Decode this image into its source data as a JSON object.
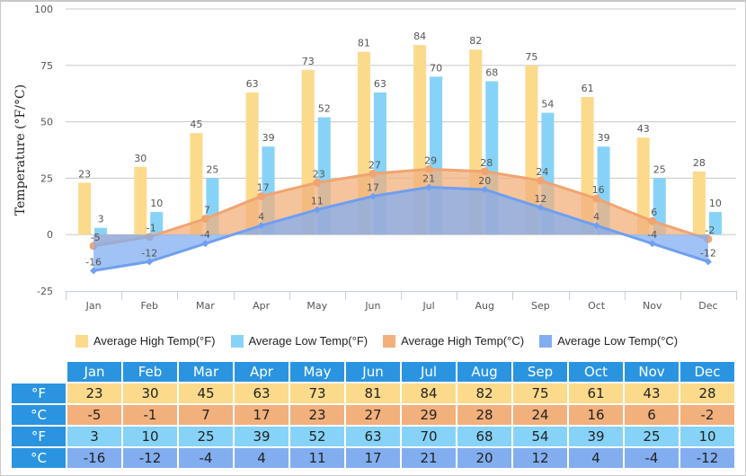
{
  "colors": {
    "high_f": "#fcda8c",
    "low_f": "#87d3f8",
    "high_c": "#f2b07c",
    "low_c": "#82aef0",
    "high_c_line": "#f0a472",
    "low_c_line": "#6f9ff0",
    "table_header": "#2a94e0"
  },
  "chart_data": {
    "type": "bar",
    "title": "",
    "xlabel": "",
    "ylabel": "Temperature (°F/°C)",
    "ylim": [
      -25,
      100
    ],
    "yticks": [
      100,
      75,
      50,
      25,
      0,
      -25
    ],
    "grid": true,
    "legend_position": "bottom",
    "categories": [
      "Jan",
      "Feb",
      "Mar",
      "Apr",
      "May",
      "Jun",
      "Jul",
      "Aug",
      "Sep",
      "Oct",
      "Nov",
      "Dec"
    ],
    "series": [
      {
        "name": "Average High Temp(°F)",
        "type": "bar",
        "values": [
          23,
          30,
          45,
          63,
          73,
          81,
          84,
          82,
          75,
          61,
          43,
          28
        ]
      },
      {
        "name": "Average Low Temp(°F)",
        "type": "bar",
        "values": [
          3,
          10,
          25,
          39,
          52,
          63,
          70,
          68,
          54,
          39,
          25,
          10
        ]
      },
      {
        "name": "Average High Temp(°C)",
        "type": "area",
        "values": [
          -5,
          -1,
          7,
          17,
          23,
          27,
          29,
          28,
          24,
          16,
          6,
          -2
        ]
      },
      {
        "name": "Average Low Temp(°C)",
        "type": "area",
        "values": [
          -16,
          -12,
          -4,
          4,
          11,
          17,
          21,
          20,
          12,
          4,
          -4,
          -12
        ]
      }
    ]
  },
  "legend": [
    {
      "label": "Average High Temp(°F)",
      "color_key": "high_f"
    },
    {
      "label": "Average Low Temp(°F)",
      "color_key": "low_f"
    },
    {
      "label": "Average High Temp(°C)",
      "color_key": "high_c"
    },
    {
      "label": "Average Low Temp(°C)",
      "color_key": "low_c"
    }
  ],
  "table": {
    "months": [
      "Jan",
      "Feb",
      "Mar",
      "Apr",
      "May",
      "Jun",
      "Jul",
      "Aug",
      "Sep",
      "Oct",
      "Nov",
      "Dec"
    ],
    "rows": [
      {
        "unit": "°F",
        "cls": "hf",
        "values": [
          "23",
          "30",
          "45",
          "63",
          "73",
          "81",
          "84",
          "82",
          "75",
          "61",
          "43",
          "28"
        ]
      },
      {
        "unit": "°C",
        "cls": "hc",
        "values": [
          "-5",
          "-1",
          "7",
          "17",
          "23",
          "27",
          "29",
          "28",
          "24",
          "16",
          "6",
          "-2"
        ]
      },
      {
        "unit": "°F",
        "cls": "lf",
        "values": [
          "3",
          "10",
          "25",
          "39",
          "52",
          "63",
          "70",
          "68",
          "54",
          "39",
          "25",
          "10"
        ]
      },
      {
        "unit": "°C",
        "cls": "lc",
        "values": [
          "-16",
          "-12",
          "-4",
          "4",
          "11",
          "17",
          "21",
          "20",
          "12",
          "4",
          "-4",
          "-12"
        ]
      }
    ]
  }
}
